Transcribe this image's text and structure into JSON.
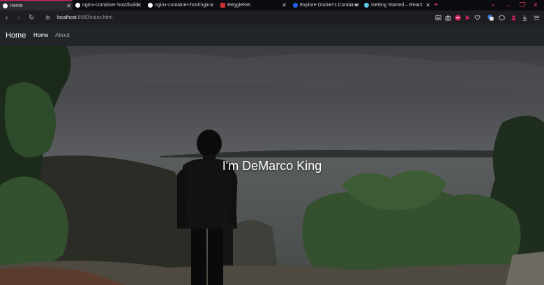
{
  "browser": {
    "tabs": [
      {
        "label": "Home",
        "icon": "globe-icon",
        "active": true
      },
      {
        "label": "nginx-container-host/build",
        "icon": "github-icon",
        "active": false
      },
      {
        "label": "nginx-container-host/ngin",
        "icon": "github-icon",
        "active": false
      },
      {
        "label": "ReggieNet",
        "icon": "reggienet-icon",
        "active": false
      },
      {
        "label": "Explore Docker's Container",
        "icon": "docker-icon",
        "active": false
      },
      {
        "label": "Getting Started – React",
        "icon": "react-icon",
        "active": false
      }
    ],
    "new_tab_label": "+",
    "url_host": "localhost",
    "url_path": ":8080/index.html",
    "accent_color": "#e0245e"
  },
  "site": {
    "brand": "Home",
    "nav": [
      {
        "label": "Home"
      },
      {
        "label": "About"
      }
    ],
    "hero_title": "I'm DeMarco King"
  }
}
